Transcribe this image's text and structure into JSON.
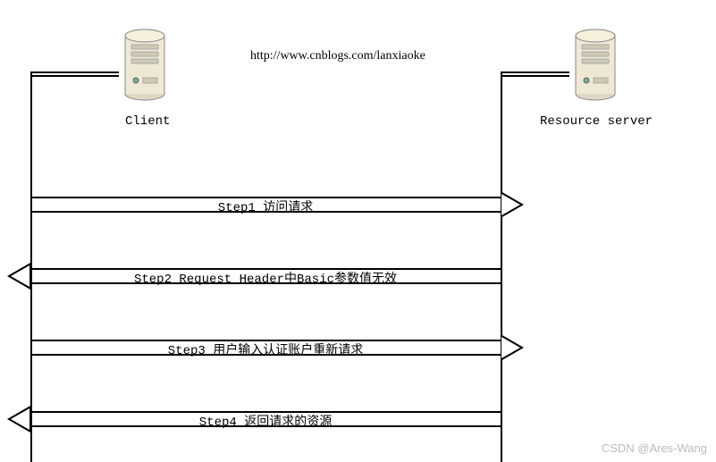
{
  "url": "http://www.cnblogs.com/lanxiaoke",
  "actors": {
    "client": "Client",
    "server": "Resource server"
  },
  "steps": {
    "s1": "Step1 访问请求",
    "s2": "Step2 Request Header中Basic参数值无效",
    "s3": "Step3 用户输入认证账户重新请求",
    "s4": "Step4 返回请求的资源"
  },
  "watermark": "CSDN @Ares-Wang",
  "chart_data": {
    "type": "sequence-diagram",
    "title": "http://www.cnblogs.com/lanxiaoke",
    "participants": [
      "Client",
      "Resource server"
    ],
    "messages": [
      {
        "from": "Client",
        "to": "Resource server",
        "label": "Step1 访问请求"
      },
      {
        "from": "Resource server",
        "to": "Client",
        "label": "Step2 Request Header中Basic参数值无效"
      },
      {
        "from": "Client",
        "to": "Resource server",
        "label": "Step3 用户输入认证账户重新请求"
      },
      {
        "from": "Resource server",
        "to": "Client",
        "label": "Step4 返回请求的资源"
      }
    ]
  }
}
